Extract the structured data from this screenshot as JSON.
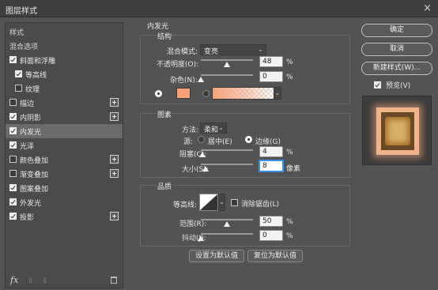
{
  "window": {
    "title": "图层样式",
    "close": "×"
  },
  "left": {
    "items": [
      {
        "label": "样式",
        "type": "header"
      },
      {
        "label": "混合选项",
        "type": "header"
      },
      {
        "label": "斜面和浮雕",
        "checked": true,
        "plus": false
      },
      {
        "label": "等高线",
        "checked": true,
        "plus": false,
        "indent": true
      },
      {
        "label": "纹理",
        "checked": false,
        "plus": false,
        "indent": true
      },
      {
        "label": "描边",
        "checked": false,
        "plus": true
      },
      {
        "label": "内阴影",
        "checked": true,
        "plus": true
      },
      {
        "label": "内发光",
        "checked": true,
        "plus": false,
        "selected": true
      },
      {
        "label": "光泽",
        "checked": true,
        "plus": false
      },
      {
        "label": "颜色叠加",
        "checked": false,
        "plus": true
      },
      {
        "label": "渐变叠加",
        "checked": false,
        "plus": true
      },
      {
        "label": "图案叠加",
        "checked": true,
        "plus": false
      },
      {
        "label": "外发光",
        "checked": true,
        "plus": false
      },
      {
        "label": "投影",
        "checked": true,
        "plus": true
      }
    ],
    "fx_label": "fx",
    "up": "⇧",
    "down": "⇩"
  },
  "main": {
    "title": "内发光",
    "structure": {
      "title": "结构",
      "blend_mode_label": "混合模式:",
      "blend_mode_value": "变亮",
      "opacity_label": "不透明度(O):",
      "opacity_value": "48",
      "noise_label": "杂色(N):",
      "noise_value": "0",
      "percent": "%",
      "glow_color": "#f5a27a",
      "gradient_start": "#f5a27a"
    },
    "elements": {
      "title": "图素",
      "method_label": "方法:",
      "method_value": "柔和",
      "source_label": "源:",
      "source_center": "居中(E)",
      "source_edge": "边缘(G)",
      "choke_label": "阻塞(C):",
      "choke_value": "4",
      "size_label": "大小(S):",
      "size_value": "8",
      "px_unit": "像素",
      "percent": "%"
    },
    "quality": {
      "title": "品质",
      "contour_label": "等高线:",
      "antialias_label": "消除锯齿(L)",
      "range_label": "范围(R):",
      "range_value": "50",
      "jitter_label": "抖动(J):",
      "jitter_value": "0",
      "percent": "%"
    },
    "buttons": {
      "set_default": "设置为默认值",
      "reset_default": "复位为默认值"
    }
  },
  "right": {
    "ok": "确定",
    "cancel": "取消",
    "new_style": "新建样式(W)...",
    "preview_label": "预览(V)",
    "preview_checked": true
  }
}
